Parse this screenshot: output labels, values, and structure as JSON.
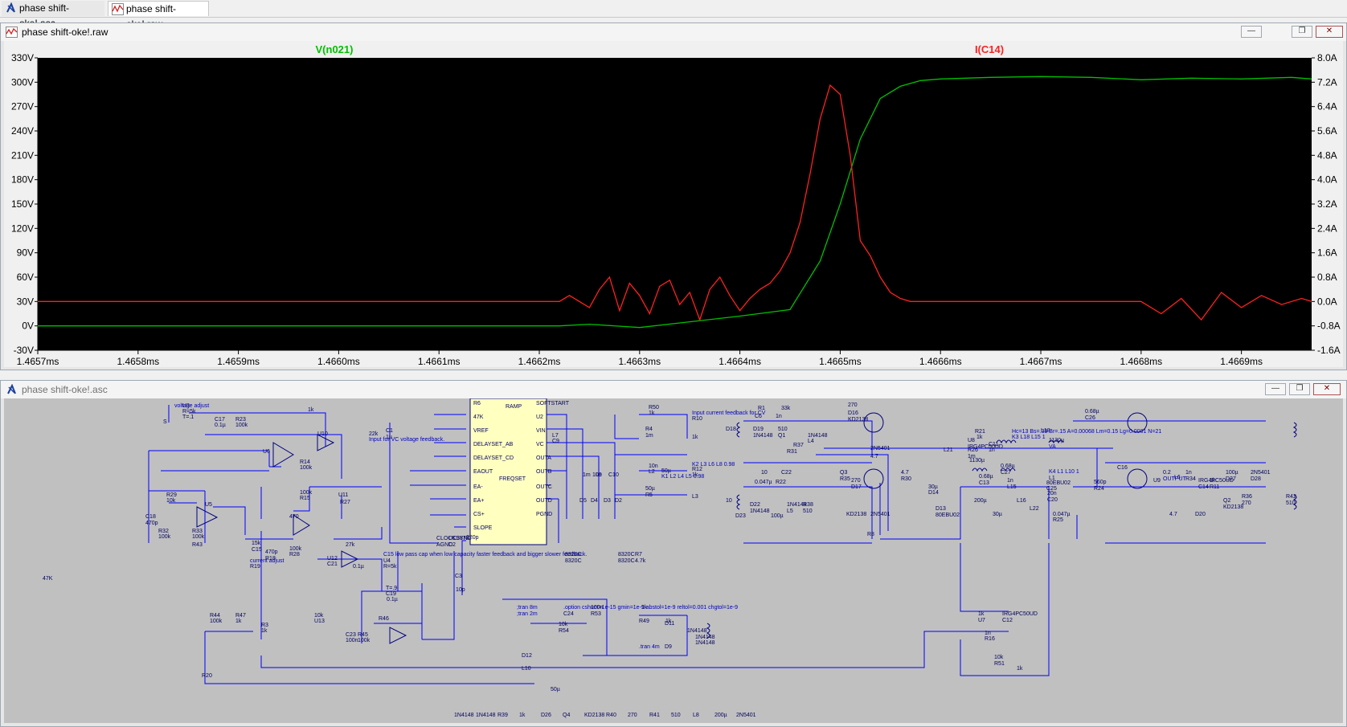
{
  "tabs": [
    {
      "label": "phase shift-oke!.asc",
      "icon": "ltspice-schematic-icon"
    },
    {
      "label": "phase shift-oke!.raw",
      "icon": "waveform-icon"
    }
  ],
  "waveform_window": {
    "title": "phase shift-oke!.raw",
    "buttons": [
      "minimize",
      "maximize",
      "close"
    ]
  },
  "schematic_window": {
    "title": "phase shift-oke!.asc",
    "buttons": [
      "minimize",
      "maximize",
      "close"
    ]
  },
  "colors": {
    "plot_bg": "#000000",
    "trace_v": "#00c000",
    "trace_i": "#ff2020",
    "axis_text": "#000000",
    "schematic_bg": "#c0c0c0",
    "wire": "#0000ff",
    "component": "#000080"
  },
  "chart_data": {
    "type": "line",
    "traces": [
      {
        "name": "V(n021)",
        "axis": "left",
        "color": "#00c000",
        "x": [
          1.4657,
          1.4662,
          1.46622,
          1.46625,
          1.4663,
          1.46635,
          1.4664,
          1.46645,
          1.46646,
          1.46648,
          1.4665,
          1.46652,
          1.46654,
          1.46656,
          1.46658,
          1.4666,
          1.46665,
          1.4667,
          1.46675,
          1.4668,
          1.46685,
          1.4669,
          1.46695,
          1.46697
        ],
        "y": [
          0,
          0,
          0,
          2,
          -2,
          5,
          12,
          20,
          40,
          80,
          150,
          230,
          280,
          295,
          302,
          304,
          306,
          307,
          306,
          303,
          305,
          304,
          306,
          304
        ]
      },
      {
        "name": "I(C14)",
        "axis": "right",
        "color": "#ff2020",
        "x": [
          1.4657,
          1.46622,
          1.46623,
          1.46625,
          1.46626,
          1.46627,
          1.46628,
          1.46629,
          1.4663,
          1.46631,
          1.46632,
          1.46633,
          1.46634,
          1.46635,
          1.46636,
          1.46637,
          1.46638,
          1.46639,
          1.4664,
          1.46641,
          1.46642,
          1.46643,
          1.46644,
          1.46645,
          1.46646,
          1.46647,
          1.46648,
          1.46649,
          1.4665,
          1.46651,
          1.46652,
          1.46653,
          1.46654,
          1.46655,
          1.46656,
          1.46657,
          1.46658,
          1.46659,
          1.4666,
          1.46662,
          1.46665,
          1.46667,
          1.46668,
          1.46669,
          1.4667,
          1.46675,
          1.4668,
          1.46682,
          1.46684,
          1.46686,
          1.46688,
          1.4669,
          1.46692,
          1.46694,
          1.46696,
          1.46697
        ],
        "y": [
          0,
          0,
          0.2,
          -0.2,
          0.4,
          0.8,
          -0.3,
          0.6,
          0.2,
          -0.4,
          0.5,
          0.7,
          -0.1,
          0.3,
          -0.6,
          0.4,
          0.8,
          0.2,
          -0.3,
          0.1,
          0.4,
          0.6,
          1.0,
          1.6,
          2.6,
          4.2,
          6.0,
          7.1,
          6.8,
          4.8,
          2.0,
          1.5,
          0.8,
          0.3,
          0.1,
          0,
          0,
          0,
          0,
          0,
          0,
          0,
          0,
          0,
          0,
          0,
          0,
          -0.4,
          0.1,
          -0.6,
          0.3,
          -0.2,
          0.2,
          -0.1,
          0.1,
          0
        ]
      }
    ],
    "title": "",
    "left_axis": {
      "ticks": [
        "330V",
        "300V",
        "270V",
        "240V",
        "210V",
        "180V",
        "150V",
        "120V",
        "90V",
        "60V",
        "30V",
        "0V",
        "-30V"
      ],
      "range": [
        -30,
        330
      ]
    },
    "right_axis": {
      "ticks": [
        "8.0A",
        "7.2A",
        "6.4A",
        "5.6A",
        "4.8A",
        "4.0A",
        "3.2A",
        "2.4A",
        "1.6A",
        "0.8A",
        "0.0A",
        "-0.8A",
        "-1.6A"
      ],
      "range": [
        -1.6,
        8.0
      ]
    },
    "x_axis": {
      "ticks": [
        "1.4657ms",
        "1.4658ms",
        "1.4659ms",
        "1.4660ms",
        "1.4661ms",
        "1.4662ms",
        "1.4663ms",
        "1.4664ms",
        "1.4665ms",
        "1.4666ms",
        "1.4667ms",
        "1.4668ms",
        "1.4669ms"
      ],
      "range": [
        1.4657,
        1.46697
      ]
    },
    "grid": false
  },
  "schematic": {
    "labels": [
      "voltage adjust",
      "R=5k",
      "T=.1",
      "S",
      "U3",
      "1k",
      "C17",
      "0.1µ",
      "R23",
      "100k",
      "U10",
      "U6",
      "R14",
      "100k",
      "R29",
      "10k",
      "U5",
      "C18",
      "470p",
      "R32",
      "100k",
      "R33",
      "100k",
      "R43",
      "100k",
      "R15",
      "470",
      "U11",
      "R27",
      "15k",
      "C15",
      "470p",
      "R18",
      "100k",
      "R28",
      "27k",
      "U12",
      "C21",
      "0.1µ",
      "current adjust",
      "R19",
      "47K",
      "C15 low pass cap when low capacity faster feedback and bigger slower feedback.",
      "U4",
      "R=5k",
      "T=.9",
      "C19",
      "0.1µ",
      "R44",
      "100k",
      "R47",
      "1k",
      "R46",
      "10k",
      "U13",
      "C23",
      "100n",
      "R45",
      "100k",
      "R3",
      "1k",
      "R20",
      "22k",
      "Input for VC voltage feedback.",
      "C1",
      "1µ",
      "R6",
      "47K",
      "VREF",
      "DELAYSET_AB",
      "DELAYSET_CD",
      "EAOUT",
      "EA-",
      "EA+",
      "CS+",
      "SLOPE",
      "RAMP",
      "SOFTSTART",
      "U2",
      "VIN",
      "VC",
      "OUTA",
      "OUTB",
      "OUTC",
      "OUTD",
      "PGND",
      "FREQSET",
      "CLOCKSYNC",
      "AGND",
      "UC3875",
      "C2",
      "220p",
      "C3",
      "10p",
      ";tran 8m",
      ";tran 2m",
      ".option cshunt=1e-15 gmin=1e-9 abstol=1e-9 reltol=0.001 chgtol=1e-9",
      "C24",
      "100n",
      "R53",
      "10k",
      "R54",
      "1k",
      "R49",
      "1k",
      ".tran 4m",
      "D9",
      "D11",
      "1N4148",
      "1N4148",
      "1N4148",
      "D12",
      "L10",
      "50µ",
      "R50",
      "1k",
      "Input current feedback for CV",
      "R10",
      "1k",
      "R4",
      "1m",
      "L7",
      "C9",
      "10n",
      "L2",
      "50µ",
      "K1 L2 L4 L5 0.98",
      "K2 L3 L6 L8 0.98",
      "R12",
      "1k",
      "L3",
      "50µ",
      "R5",
      "1m",
      "L9",
      "C10",
      "10n",
      "D5",
      "D4",
      "D3",
      "D2",
      "8320C",
      "8320C",
      "8320C",
      "8320C",
      "R7",
      "4.7k",
      "R1",
      "33k",
      "C6",
      "1n",
      "D18",
      "D19",
      "1N4148",
      "1N4148",
      "L4",
      "R37",
      "510",
      "Q1",
      "R31",
      "270",
      "D16",
      "KD2138",
      "2N5401",
      "4.7",
      "R21",
      "1k",
      "U8",
      "IRG4PC50UD",
      "C11",
      "1n",
      "Hc=13 Bs=.39 Br=.15 A=0.00068 Lm=0.15 Lg=0.0001 N=21",
      "K3 L18 L15 1",
      "R26",
      "1m",
      "L21",
      "1130µ",
      "L18",
      "1130µ",
      "VA",
      "K4 L1 L10 1",
      "L1",
      "20n",
      "C20",
      "0.68µ",
      "C26",
      "0.68µ",
      "C27",
      "0.68µ",
      "C13",
      "1n",
      "L15",
      "200µ",
      "L16",
      "30µ",
      "L22",
      "30µ",
      "D14",
      "D13",
      "80EBU02",
      "80EBU02",
      "C25",
      "0.047µ",
      "R25",
      "10",
      "C22",
      "0.047µ",
      "R22",
      "10",
      "D23",
      "D22",
      "1N4148",
      "1N4148",
      "L5",
      "100µ",
      "R38",
      "510",
      "Q3",
      "R35",
      "270",
      "D17",
      "KD2138",
      "2N5401",
      "R8",
      "4.7",
      "R30",
      "1k",
      "U7",
      "IRG4PC50UD",
      "C12",
      "1n",
      "R16",
      "10k",
      "R51",
      "1k",
      "C16",
      "560p",
      "R24",
      "0.2",
      "OUTPUT",
      "U9",
      "IRG4PC50UD",
      "C14",
      "1n",
      "R34",
      "1k",
      "R11",
      "4.7",
      "D20",
      "Q2",
      "KD2138",
      "R36",
      "270",
      "R42",
      "510",
      "L6",
      "100µ",
      "2N5401",
      "D27",
      "D28",
      "1N4148",
      "1N4148",
      "R39",
      "1k",
      "D26",
      "Q4",
      "KD2138",
      "R40",
      "270",
      "R41",
      "510",
      "L8",
      "200µ",
      "2N5401"
    ]
  }
}
